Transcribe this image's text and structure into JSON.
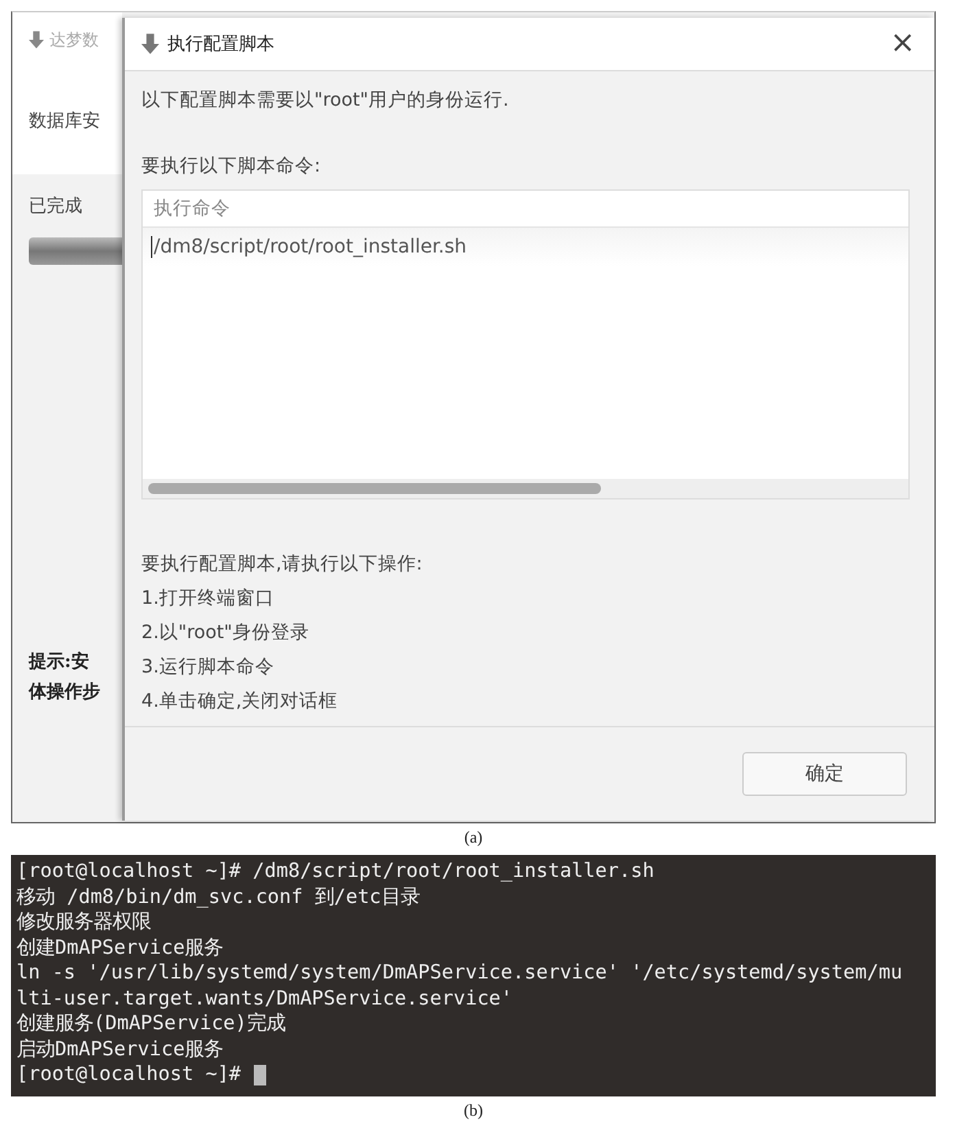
{
  "figure_a": {
    "caption": "(a)",
    "background_window": {
      "title": "达梦数",
      "heading": "数据库安",
      "progress_label": "已完成",
      "progress": {
        "level": 1
      },
      "hint_lines": [
        "提示:安",
        "体操作步"
      ]
    },
    "dialog": {
      "title": "执行配置脚本",
      "close": "×",
      "intro": "以下配置脚本需要以\"root\"用户的身份运行.",
      "commands_label": "要执行以下脚本命令:",
      "table": {
        "columns": [
          "执行命令"
        ],
        "rows": [
          [
            "/dm8/script/root/root_installer.sh"
          ]
        ]
      },
      "instructions_title": "要执行配置脚本,请执行以下操作:",
      "steps": [
        "1.打开终端窗口",
        "2.以\"root\"身份登录",
        "3.运行脚本命令",
        "4.单击确定,关闭对话框"
      ],
      "buttons": [
        "确定"
      ]
    }
  },
  "figure_b": {
    "caption": "(b)",
    "terminal": {
      "lines": [
        "[root@localhost ~]# /dm8/script/root/root_installer.sh",
        "移动 /dm8/bin/dm_svc.conf 到/etc目录",
        "修改服务器权限",
        "创建DmAPService服务",
        "ln -s '/usr/lib/systemd/system/DmAPService.service' '/etc/systemd/system/mu",
        "lti-user.target.wants/DmAPService.service'",
        "创建服务(DmAPService)完成",
        "启动DmAPService服务",
        "[root@localhost ~]#"
      ],
      "cursor": true
    }
  }
}
